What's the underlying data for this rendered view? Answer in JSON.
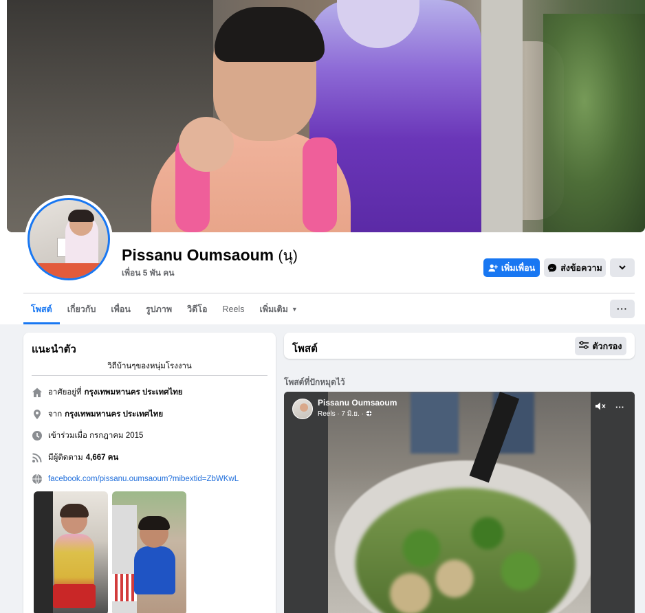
{
  "profile": {
    "name": "Pissanu Oumsaoum",
    "nickname": "(นุ)",
    "friends": "เพื่อน 5 พัน คน"
  },
  "actions": {
    "add_friend": "เพิ่มเพื่อน",
    "message": "ส่งข้อความ"
  },
  "tabs": [
    {
      "label": "โพสต์",
      "active": true
    },
    {
      "label": "เกี่ยวกับ"
    },
    {
      "label": "เพื่อน"
    },
    {
      "label": "รูปภาพ"
    },
    {
      "label": "วิดีโอ"
    },
    {
      "label": "Reels"
    },
    {
      "label": "เพิ่มเติม"
    }
  ],
  "intro": {
    "title": "แนะนำตัว",
    "bio": "วิถีบ้านๆของหนุ่มโรงงาน",
    "lives_prefix": "อาศัยอยู่ที่",
    "lives_value": "กรุงเทพมหานคร ประเทศไทย",
    "from_prefix": "จาก",
    "from_value": "กรุงเทพมหานคร ประเทศไทย",
    "joined": "เข้าร่วมเมื่อ กรกฎาคม 2015",
    "followers_prefix": "มีผู้ติดตาม",
    "followers_value": "4,667 คน",
    "link": "facebook.com/pissanu.oumsaoum?mibextid=ZbWKwL"
  },
  "posts": {
    "title": "โพสต์",
    "filter": "ตัวกรอง",
    "pinned_label": "โพสต์ที่ปักหมุดไว้"
  },
  "reel": {
    "author": "Pissanu Oumsaoum",
    "meta": "Reels · 7 มิ.ย. ·"
  },
  "colors": {
    "accent": "#1877f2",
    "background": "#f0f2f5"
  },
  "icons": {
    "add_friend": "person-plus-icon",
    "message": "messenger-icon",
    "home": "home-icon",
    "location": "location-pin-icon",
    "clock": "clock-icon",
    "followers": "rss-icon",
    "link": "globe-icon",
    "filter": "sliders-icon",
    "mute": "speaker-muted-icon"
  }
}
